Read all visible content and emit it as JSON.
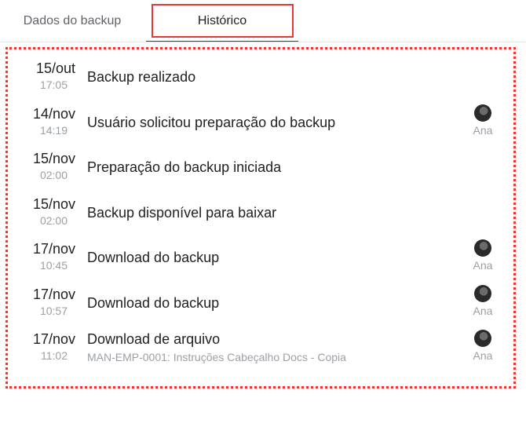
{
  "tabs": [
    {
      "label": "Dados do backup",
      "active": false
    },
    {
      "label": "Histórico",
      "active": true
    }
  ],
  "history": [
    {
      "date": "15/out",
      "time": "17:05",
      "title": "Backup realizado",
      "subtitle": "",
      "user": ""
    },
    {
      "date": "14/nov",
      "time": "14:19",
      "title": "Usuário solicitou preparação do backup",
      "subtitle": "",
      "user": "Ana"
    },
    {
      "date": "15/nov",
      "time": "02:00",
      "title": "Preparação do backup iniciada",
      "subtitle": "",
      "user": ""
    },
    {
      "date": "15/nov",
      "time": "02:00",
      "title": "Backup disponível para baixar",
      "subtitle": "",
      "user": ""
    },
    {
      "date": "17/nov",
      "time": "10:45",
      "title": "Download do backup",
      "subtitle": "",
      "user": "Ana"
    },
    {
      "date": "17/nov",
      "time": "10:57",
      "title": "Download do backup",
      "subtitle": "",
      "user": "Ana"
    },
    {
      "date": "17/nov",
      "time": "11:02",
      "title": "Download de arquivo",
      "subtitle": "MAN-EMP-0001: Instruções Cabeçalho Docs - Copia",
      "user": "Ana"
    }
  ]
}
